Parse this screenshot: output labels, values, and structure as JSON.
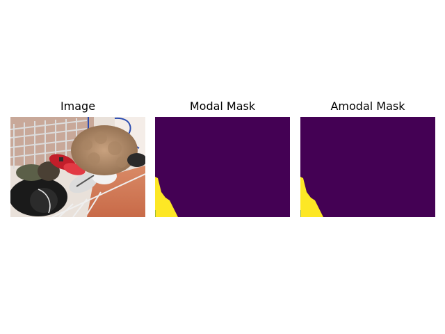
{
  "panels": [
    {
      "title": "Image"
    },
    {
      "title": "Modal Mask"
    },
    {
      "title": "Amodal Mask"
    }
  ],
  "colors": {
    "mask_background": "#440154",
    "mask_foreground": "#fde725",
    "mask_edge": "#3b8a3d"
  }
}
